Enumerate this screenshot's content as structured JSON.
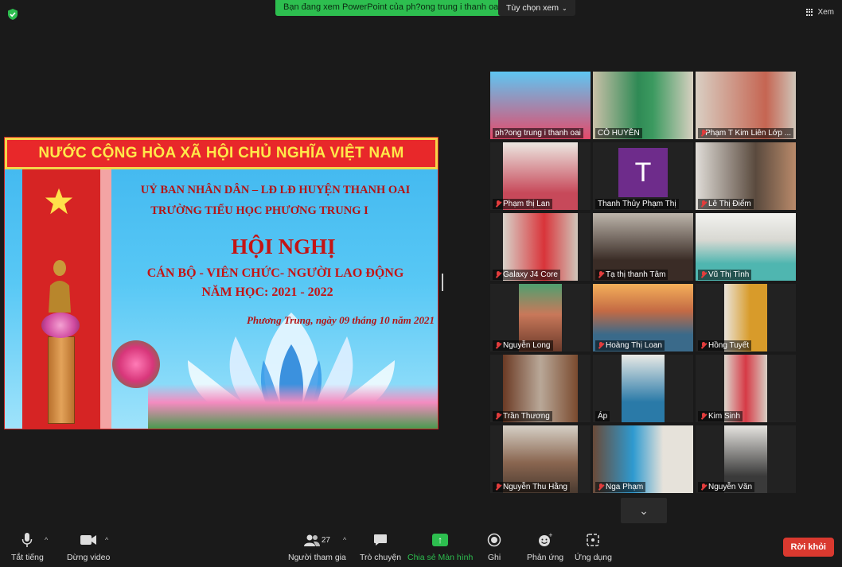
{
  "top": {
    "share_banner": "Bạn đang xem PowerPoint của ph?ong trung i thanh oai",
    "view_options": "Tùy chọn xem",
    "view_button": "Xem"
  },
  "slide": {
    "header": "NƯỚC CỘNG HÒA XÃ HỘI CHỦ NGHĨA VIỆT NAM",
    "line1": "UỶ BAN NHÂN DÂN – LĐ LĐ HUYỆN THANH OAI",
    "line2": "TRƯỜNG TIỂU HỌC PHƯƠNG TRUNG I",
    "title": "HỘI NGHỊ",
    "subtitle1": "CÁN BỘ - VIÊN CHỨC- NGƯỜI LAO ĐỘNG",
    "subtitle2": "NĂM HỌC: 2021 - 2022",
    "dateline": "Phương Trung, ngày  09 tháng 10 năm 2021"
  },
  "participants": [
    {
      "name": "ph?ong trung i thanh oai",
      "muted": false,
      "active": true
    },
    {
      "name": "CÔ HUYỀN",
      "muted": false
    },
    {
      "name": "Phạm T Kim Liên Lớp ...",
      "muted": true
    },
    {
      "name": "Phạm thị Lan",
      "muted": true
    },
    {
      "name": "Thanh Thủy Phạm Thị",
      "muted": false,
      "initial": "T"
    },
    {
      "name": "Lê Thị Điểm",
      "muted": true
    },
    {
      "name": "Galaxy J4 Core",
      "muted": true
    },
    {
      "name": "Tạ thị thanh Tâm",
      "muted": true
    },
    {
      "name": "Vũ Thị Tình",
      "muted": true
    },
    {
      "name": "Nguyễn Long",
      "muted": true
    },
    {
      "name": "Hoàng Thị Loan",
      "muted": true
    },
    {
      "name": "Hồng Tuyết",
      "muted": true
    },
    {
      "name": "Trần Thương",
      "muted": true
    },
    {
      "name": "Áp",
      "muted": false
    },
    {
      "name": "Kim Sinh",
      "muted": true
    },
    {
      "name": "Nguyễn Thu Hằng",
      "muted": true
    },
    {
      "name": "Nga Phạm",
      "muted": true
    },
    {
      "name": "Nguyễn Văn",
      "muted": true
    }
  ],
  "toolbar": {
    "mute": "Tắt tiếng",
    "video": "Dừng video",
    "participants": "Người tham gia",
    "participants_count": "27",
    "chat": "Trò chuyện",
    "share": "Chia sẻ Màn hình",
    "record": "Ghi",
    "reactions": "Phản ứng",
    "apps": "Ứng dụng",
    "leave": "Rời khỏi"
  },
  "colors": {
    "share_green": "#2dbe4f",
    "leave_red": "#d9392f",
    "active_outline": "#f2d22e"
  }
}
